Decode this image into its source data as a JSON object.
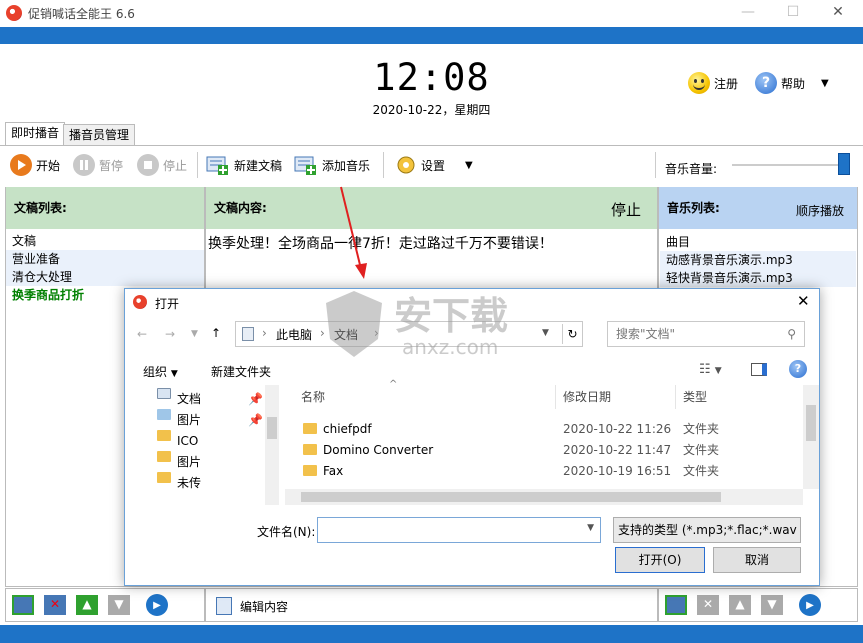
{
  "app": {
    "title": "促销喊话全能王 6.6",
    "clock": "12:08",
    "date": "2020-10-22，星期四",
    "register_label": "注册",
    "help_label": "帮助",
    "tabs": [
      {
        "label": "即时播音",
        "active": true
      },
      {
        "label": "播音员管理",
        "active": false
      }
    ],
    "toolbar": {
      "start": "开始",
      "pause": "暂停",
      "stop": "停止",
      "new_script": "新建文稿",
      "add_music": "添加音乐",
      "settings": "设置",
      "volume_label": "音乐音量:"
    },
    "script_list": {
      "header": "文稿列表:",
      "column": "文稿",
      "items": [
        {
          "label": "营业准备",
          "active": false
        },
        {
          "label": "清仓大处理",
          "active": false
        },
        {
          "label": "换季商品打折",
          "active": true
        }
      ]
    },
    "content": {
      "header": "文稿内容:",
      "status": "停止",
      "text": "换季处理！全场商品一律7折！走过路过千万不要错误！",
      "edit_label": "编辑内容"
    },
    "music_list": {
      "header": "音乐列表:",
      "mode": "顺序播放",
      "column": "曲目",
      "items": [
        "动感背景音乐演示.mp3",
        "轻快背景音乐演示.mp3"
      ]
    },
    "colors": {
      "accent_blue": "#1e73c7",
      "green_header": "#c6e2c6",
      "blue_header": "#b9d3f2",
      "active_item": "#008000"
    }
  },
  "dialog": {
    "title": "打开",
    "breadcrumb": [
      "此电脑",
      "文档"
    ],
    "search_placeholder": "搜索\"文档\"",
    "organize": "组织",
    "new_folder": "新建文件夹",
    "tree": [
      {
        "label": "文档",
        "pinned": true
      },
      {
        "label": "图片",
        "pinned": true
      },
      {
        "label": "ICO",
        "pinned": false
      },
      {
        "label": "图片",
        "pinned": false
      },
      {
        "label": "未传",
        "pinned": false
      }
    ],
    "columns": [
      "名称",
      "修改日期",
      "类型"
    ],
    "files": [
      {
        "name": "chiefpdf",
        "date": "2020-10-22 11:26",
        "type": "文件夹"
      },
      {
        "name": "Domino Converter",
        "date": "2020-10-22 11:47",
        "type": "文件夹"
      },
      {
        "name": "Fax",
        "date": "2020-10-19 16:51",
        "type": "文件夹"
      }
    ],
    "filename_label": "文件名(N):",
    "filename_value": "",
    "filetype": "支持的类型 (*.mp3;*.flac;*.wav",
    "open": "打开(O)",
    "cancel": "取消"
  },
  "watermark": {
    "text": "安下载",
    "sub": "anxz.com"
  }
}
